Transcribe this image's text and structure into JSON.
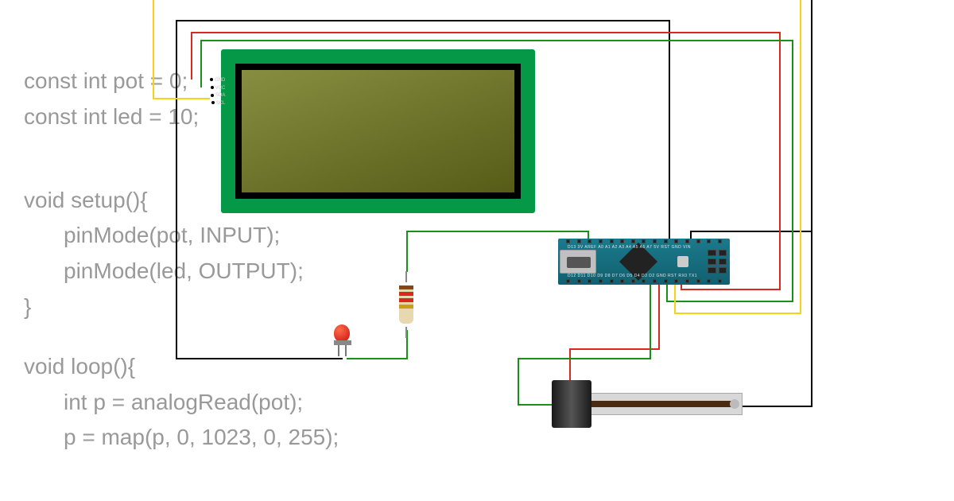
{
  "code": {
    "line1": "const int pot = 0;",
    "line2": "const int led = 10;",
    "line3": "void setup(){",
    "line4": "pinMode(pot, INPUT);",
    "line5": "pinMode(led, OUTPUT);",
    "line6": "}",
    "line7": "void loop(){",
    "line8": "int p = analogRead(pot);",
    "line9": "p = map(p, 0, 1023, 0, 255);"
  },
  "lcd": {
    "pins": [
      "GND",
      "VCC",
      "SDA",
      "SCL"
    ]
  },
  "nano": {
    "label_top": "D13 3V AREF A0 A1 A2 A3 A4 A5 A6 A7 5V RST GND VIN",
    "label_bot": "D12 D11 D10 D9 D8 D7 D6 D5 D4 D3 D2 GND RST RX0 TX1"
  },
  "resistor": {
    "bands": [
      "#8b4513",
      "#d9281e",
      "#d9281e",
      "#c9a014"
    ]
  },
  "colors": {
    "wire_black": "#000000",
    "wire_red": "#d9281e",
    "wire_green": "#1a8f1a",
    "wire_yellow": "#f7d21a",
    "lcd_pcb": "#059847",
    "nano_pcb": "#1a7a8c"
  }
}
